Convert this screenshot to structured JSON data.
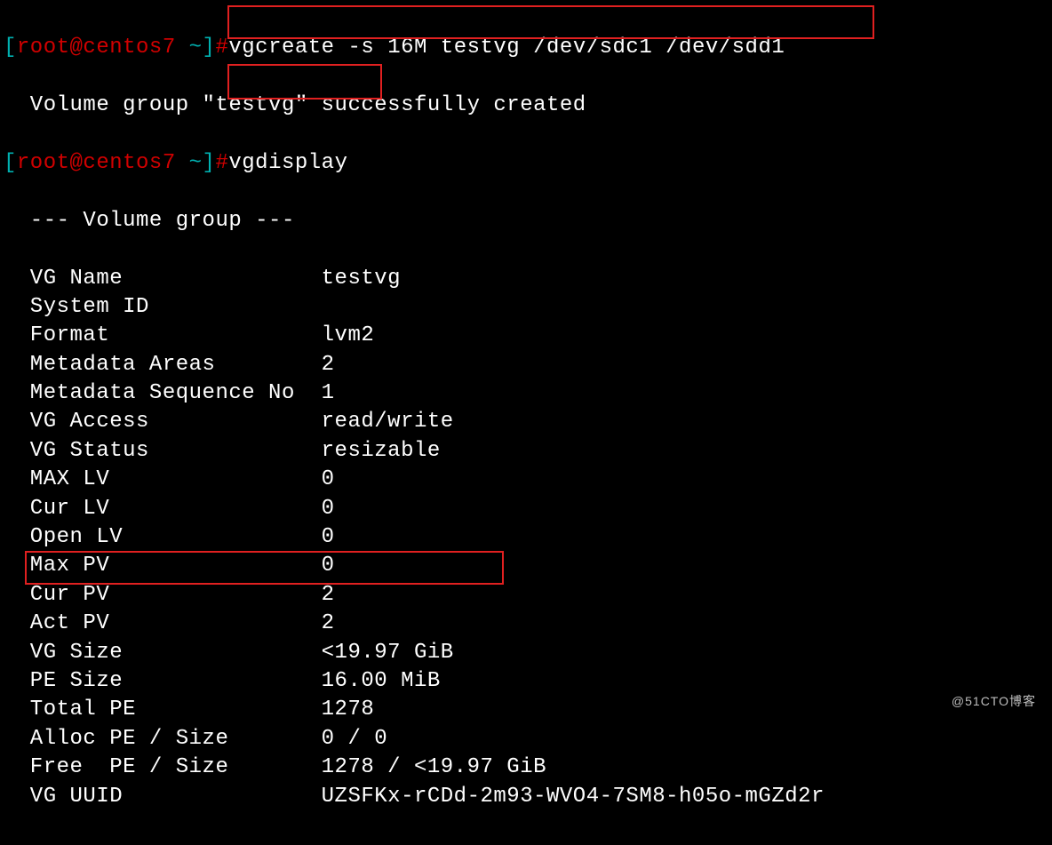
{
  "prompt": {
    "bracket_open": "[",
    "user_host": "root@centos7",
    "separator": " ",
    "path": "~",
    "bracket_close": "]",
    "hash": "#"
  },
  "commands": {
    "vgcreate": "vgcreate -s 16M testvg /dev/sdc1 /dev/sdd1",
    "vgdisplay": "vgdisplay"
  },
  "output": {
    "created": "  Volume group \"testvg\" successfully created",
    "header": "  --- Volume group ---",
    "rows": [
      {
        "label": "  VG Name               ",
        "value": "testvg"
      },
      {
        "label": "  System ID             ",
        "value": ""
      },
      {
        "label": "  Format                ",
        "value": "lvm2"
      },
      {
        "label": "  Metadata Areas        ",
        "value": "2"
      },
      {
        "label": "  Metadata Sequence No  ",
        "value": "1"
      },
      {
        "label": "  VG Access             ",
        "value": "read/write"
      },
      {
        "label": "  VG Status             ",
        "value": "resizable"
      },
      {
        "label": "  MAX LV                ",
        "value": "0"
      },
      {
        "label": "  Cur LV                ",
        "value": "0"
      },
      {
        "label": "  Open LV               ",
        "value": "0"
      },
      {
        "label": "  Max PV                ",
        "value": "0"
      },
      {
        "label": "  Cur PV                ",
        "value": "2"
      },
      {
        "label": "  Act PV                ",
        "value": "2"
      },
      {
        "label": "  VG Size               ",
        "value": "<19.97 GiB"
      },
      {
        "label": "  PE Size               ",
        "value": "16.00 MiB"
      },
      {
        "label": "  Total PE              ",
        "value": "1278"
      },
      {
        "label": "  Alloc PE / Size       ",
        "value": "0 / 0"
      },
      {
        "label": "  Free  PE / Size       ",
        "value": "1278 / <19.97 GiB"
      },
      {
        "label": "  VG UUID               ",
        "value": "UZSFKx-rCDd-2m93-WVO4-7SM8-h05o-mGZd2r"
      }
    ]
  },
  "watermark": "@51CTO博客"
}
